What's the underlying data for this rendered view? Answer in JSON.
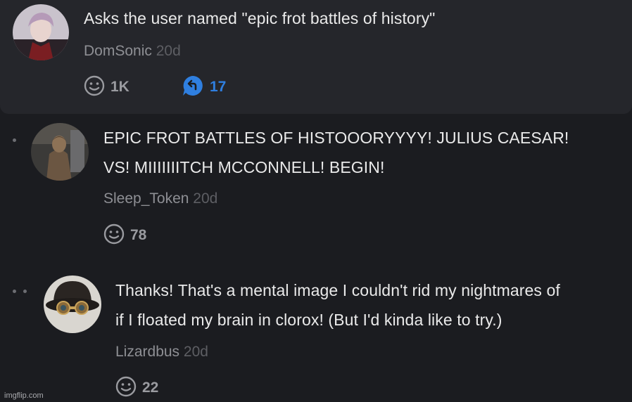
{
  "comments": [
    {
      "text_lines": [
        "Asks the user named \"epic frot battles of history\""
      ],
      "username": "DomSonic",
      "time": "20d",
      "likes": "1K",
      "replies": "17"
    },
    {
      "text_lines": [
        "EPIC FROT BATTLES OF HISTOOORYYYY! JULIUS CAESAR!",
        "VS! MIIIIIIITCH MCCONNELL! BEGIN!"
      ],
      "username": "Sleep_Token",
      "time": "20d",
      "likes": "78"
    },
    {
      "text_lines": [
        "Thanks! That's a mental image I couldn't rid my nightmares of",
        "if I floated my brain in clorox! (But I'd kinda like to try.)"
      ],
      "username": "Lizardbus",
      "time": "20d",
      "likes": "22"
    }
  ],
  "watermark": "imgflip.com",
  "colors": {
    "background": "#1b1c20",
    "card": "#25262b",
    "text": "#eaeaea",
    "username": "#8e8f94",
    "time": "#5d5e63",
    "reply_accent": "#2f7fe0"
  }
}
